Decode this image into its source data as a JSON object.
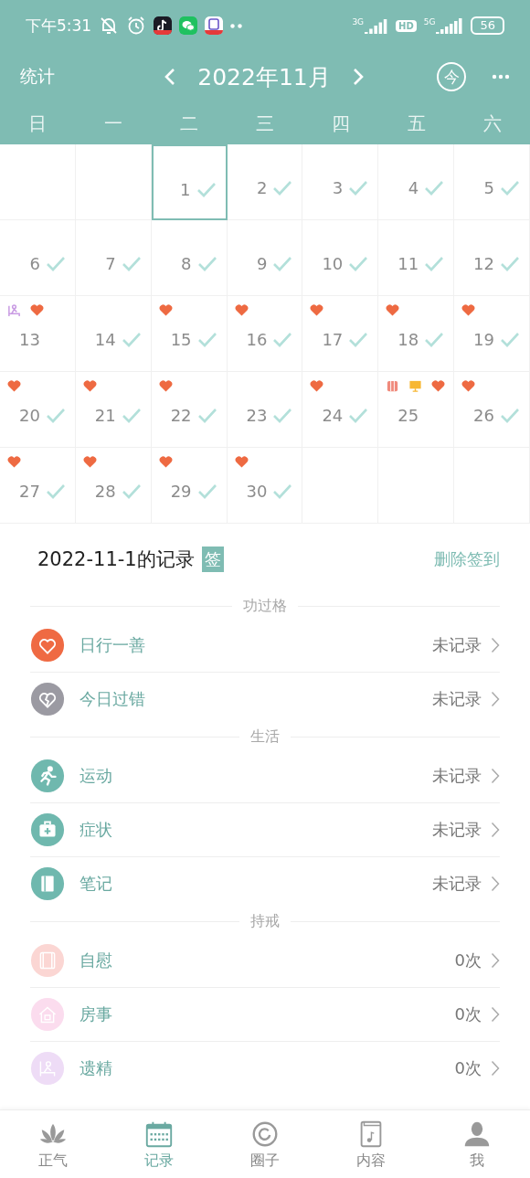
{
  "status_bar": {
    "time": "下午5:31",
    "net_1": "3G",
    "hd": "HD",
    "net_2": "5G",
    "battery": "56"
  },
  "header": {
    "left": "统计",
    "title": "2022年11月",
    "today": "今"
  },
  "weekdays": [
    "日",
    "一",
    "二",
    "三",
    "四",
    "五",
    "六"
  ],
  "weeks": [
    [
      {
        "kind": "blank"
      },
      {
        "kind": "blank"
      },
      {
        "kind": "day",
        "number": "1",
        "checked": true,
        "selected": true
      },
      {
        "kind": "day",
        "number": "2",
        "checked": true,
        "selected": false
      },
      {
        "kind": "day",
        "number": "3",
        "checked": true,
        "selected": false
      },
      {
        "kind": "day",
        "number": "4",
        "checked": true,
        "selected": false
      },
      {
        "kind": "day",
        "number": "5",
        "checked": true,
        "selected": false
      }
    ],
    [
      {
        "kind": "day",
        "number": "6",
        "checked": true,
        "selected": false
      },
      {
        "kind": "day",
        "number": "7",
        "checked": true,
        "selected": false
      },
      {
        "kind": "day",
        "number": "8",
        "checked": true,
        "selected": false
      },
      {
        "kind": "day",
        "number": "9",
        "checked": true,
        "selected": false
      },
      {
        "kind": "day",
        "number": "10",
        "checked": true,
        "selected": false
      },
      {
        "kind": "day",
        "number": "11",
        "checked": true,
        "selected": false
      },
      {
        "kind": "day",
        "number": "12",
        "checked": true,
        "selected": false
      }
    ],
    [
      {
        "kind": "day",
        "number": "13",
        "checked": false,
        "selected": false,
        "markers": [
          {
            "kind": "figure"
          },
          {
            "kind": "heart"
          }
        ]
      },
      {
        "kind": "day",
        "number": "14",
        "checked": true,
        "selected": false
      },
      {
        "kind": "day",
        "number": "15",
        "checked": true,
        "selected": false,
        "markers": [
          {
            "kind": "heart"
          }
        ]
      },
      {
        "kind": "day",
        "number": "16",
        "checked": true,
        "selected": false,
        "markers": [
          {
            "kind": "heart"
          }
        ]
      },
      {
        "kind": "day",
        "number": "17",
        "checked": true,
        "selected": false,
        "markers": [
          {
            "kind": "heart"
          }
        ]
      },
      {
        "kind": "day",
        "number": "18",
        "checked": true,
        "selected": false,
        "markers": [
          {
            "kind": "heart"
          }
        ]
      },
      {
        "kind": "day",
        "number": "19",
        "checked": true,
        "selected": false,
        "markers": [
          {
            "kind": "heart"
          }
        ]
      }
    ],
    [
      {
        "kind": "day",
        "number": "20",
        "checked": true,
        "selected": false,
        "markers": [
          {
            "kind": "heart"
          }
        ]
      },
      {
        "kind": "day",
        "number": "21",
        "checked": true,
        "selected": false,
        "markers": [
          {
            "kind": "heart"
          }
        ]
      },
      {
        "kind": "day",
        "number": "22",
        "checked": true,
        "selected": false,
        "markers": [
          {
            "kind": "heart"
          }
        ]
      },
      {
        "kind": "day",
        "number": "23",
        "checked": true,
        "selected": false
      },
      {
        "kind": "day",
        "number": "24",
        "checked": true,
        "selected": false,
        "markers": [
          {
            "kind": "heart"
          }
        ]
      },
      {
        "kind": "day",
        "number": "25",
        "checked": false,
        "selected": false,
        "markers": [
          {
            "kind": "roll"
          },
          {
            "kind": "screen"
          },
          {
            "kind": "heart"
          }
        ]
      },
      {
        "kind": "day",
        "number": "26",
        "checked": true,
        "selected": false,
        "markers": [
          {
            "kind": "heart"
          }
        ]
      }
    ],
    [
      {
        "kind": "day",
        "number": "27",
        "checked": true,
        "selected": false,
        "markers": [
          {
            "kind": "heart"
          }
        ]
      },
      {
        "kind": "day",
        "number": "28",
        "checked": true,
        "selected": false,
        "markers": [
          {
            "kind": "heart"
          }
        ]
      },
      {
        "kind": "day",
        "number": "29",
        "checked": true,
        "selected": false,
        "markers": [
          {
            "kind": "heart"
          }
        ]
      },
      {
        "kind": "day",
        "number": "30",
        "checked": true,
        "selected": false,
        "markers": [
          {
            "kind": "heart"
          }
        ]
      },
      {
        "kind": "blank"
      },
      {
        "kind": "blank"
      },
      {
        "kind": "blank"
      }
    ]
  ],
  "record": {
    "title": "2022-11-1的记录",
    "badge": "签",
    "action": "删除签到",
    "sections": [
      {
        "title": "功过格",
        "items": [
          {
            "label": "日行一善",
            "kind": "heart",
            "color": "#ef6a43",
            "value": "未记录"
          },
          {
            "label": "今日过错",
            "kind": "broken-heart",
            "color": "#9b9aa2",
            "value": "未记录"
          }
        ]
      },
      {
        "title": "生活",
        "items": [
          {
            "label": "运动",
            "kind": "runner",
            "color": "#6fb8ae",
            "value": "未记录"
          },
          {
            "label": "症状",
            "kind": "medkit",
            "color": "#6fb8ae",
            "value": "未记录"
          },
          {
            "label": "笔记",
            "kind": "notebook",
            "color": "#6fb8ae",
            "value": "未记录"
          }
        ]
      },
      {
        "title": "持戒",
        "items": [
          {
            "label": "自慰",
            "kind": "roll",
            "color": "#fbd6d3",
            "value": "0次"
          },
          {
            "label": "房事",
            "kind": "house",
            "color": "#fbdcee",
            "value": "0次"
          },
          {
            "label": "遗精",
            "kind": "figure",
            "color": "#eedcf6",
            "value": "0次"
          }
        ]
      }
    ]
  },
  "nav": [
    {
      "label": "正气",
      "selected": false
    },
    {
      "label": "记录",
      "selected": true
    },
    {
      "label": "圈子",
      "selected": false
    },
    {
      "label": "内容",
      "selected": false
    },
    {
      "label": "我",
      "selected": false
    }
  ]
}
